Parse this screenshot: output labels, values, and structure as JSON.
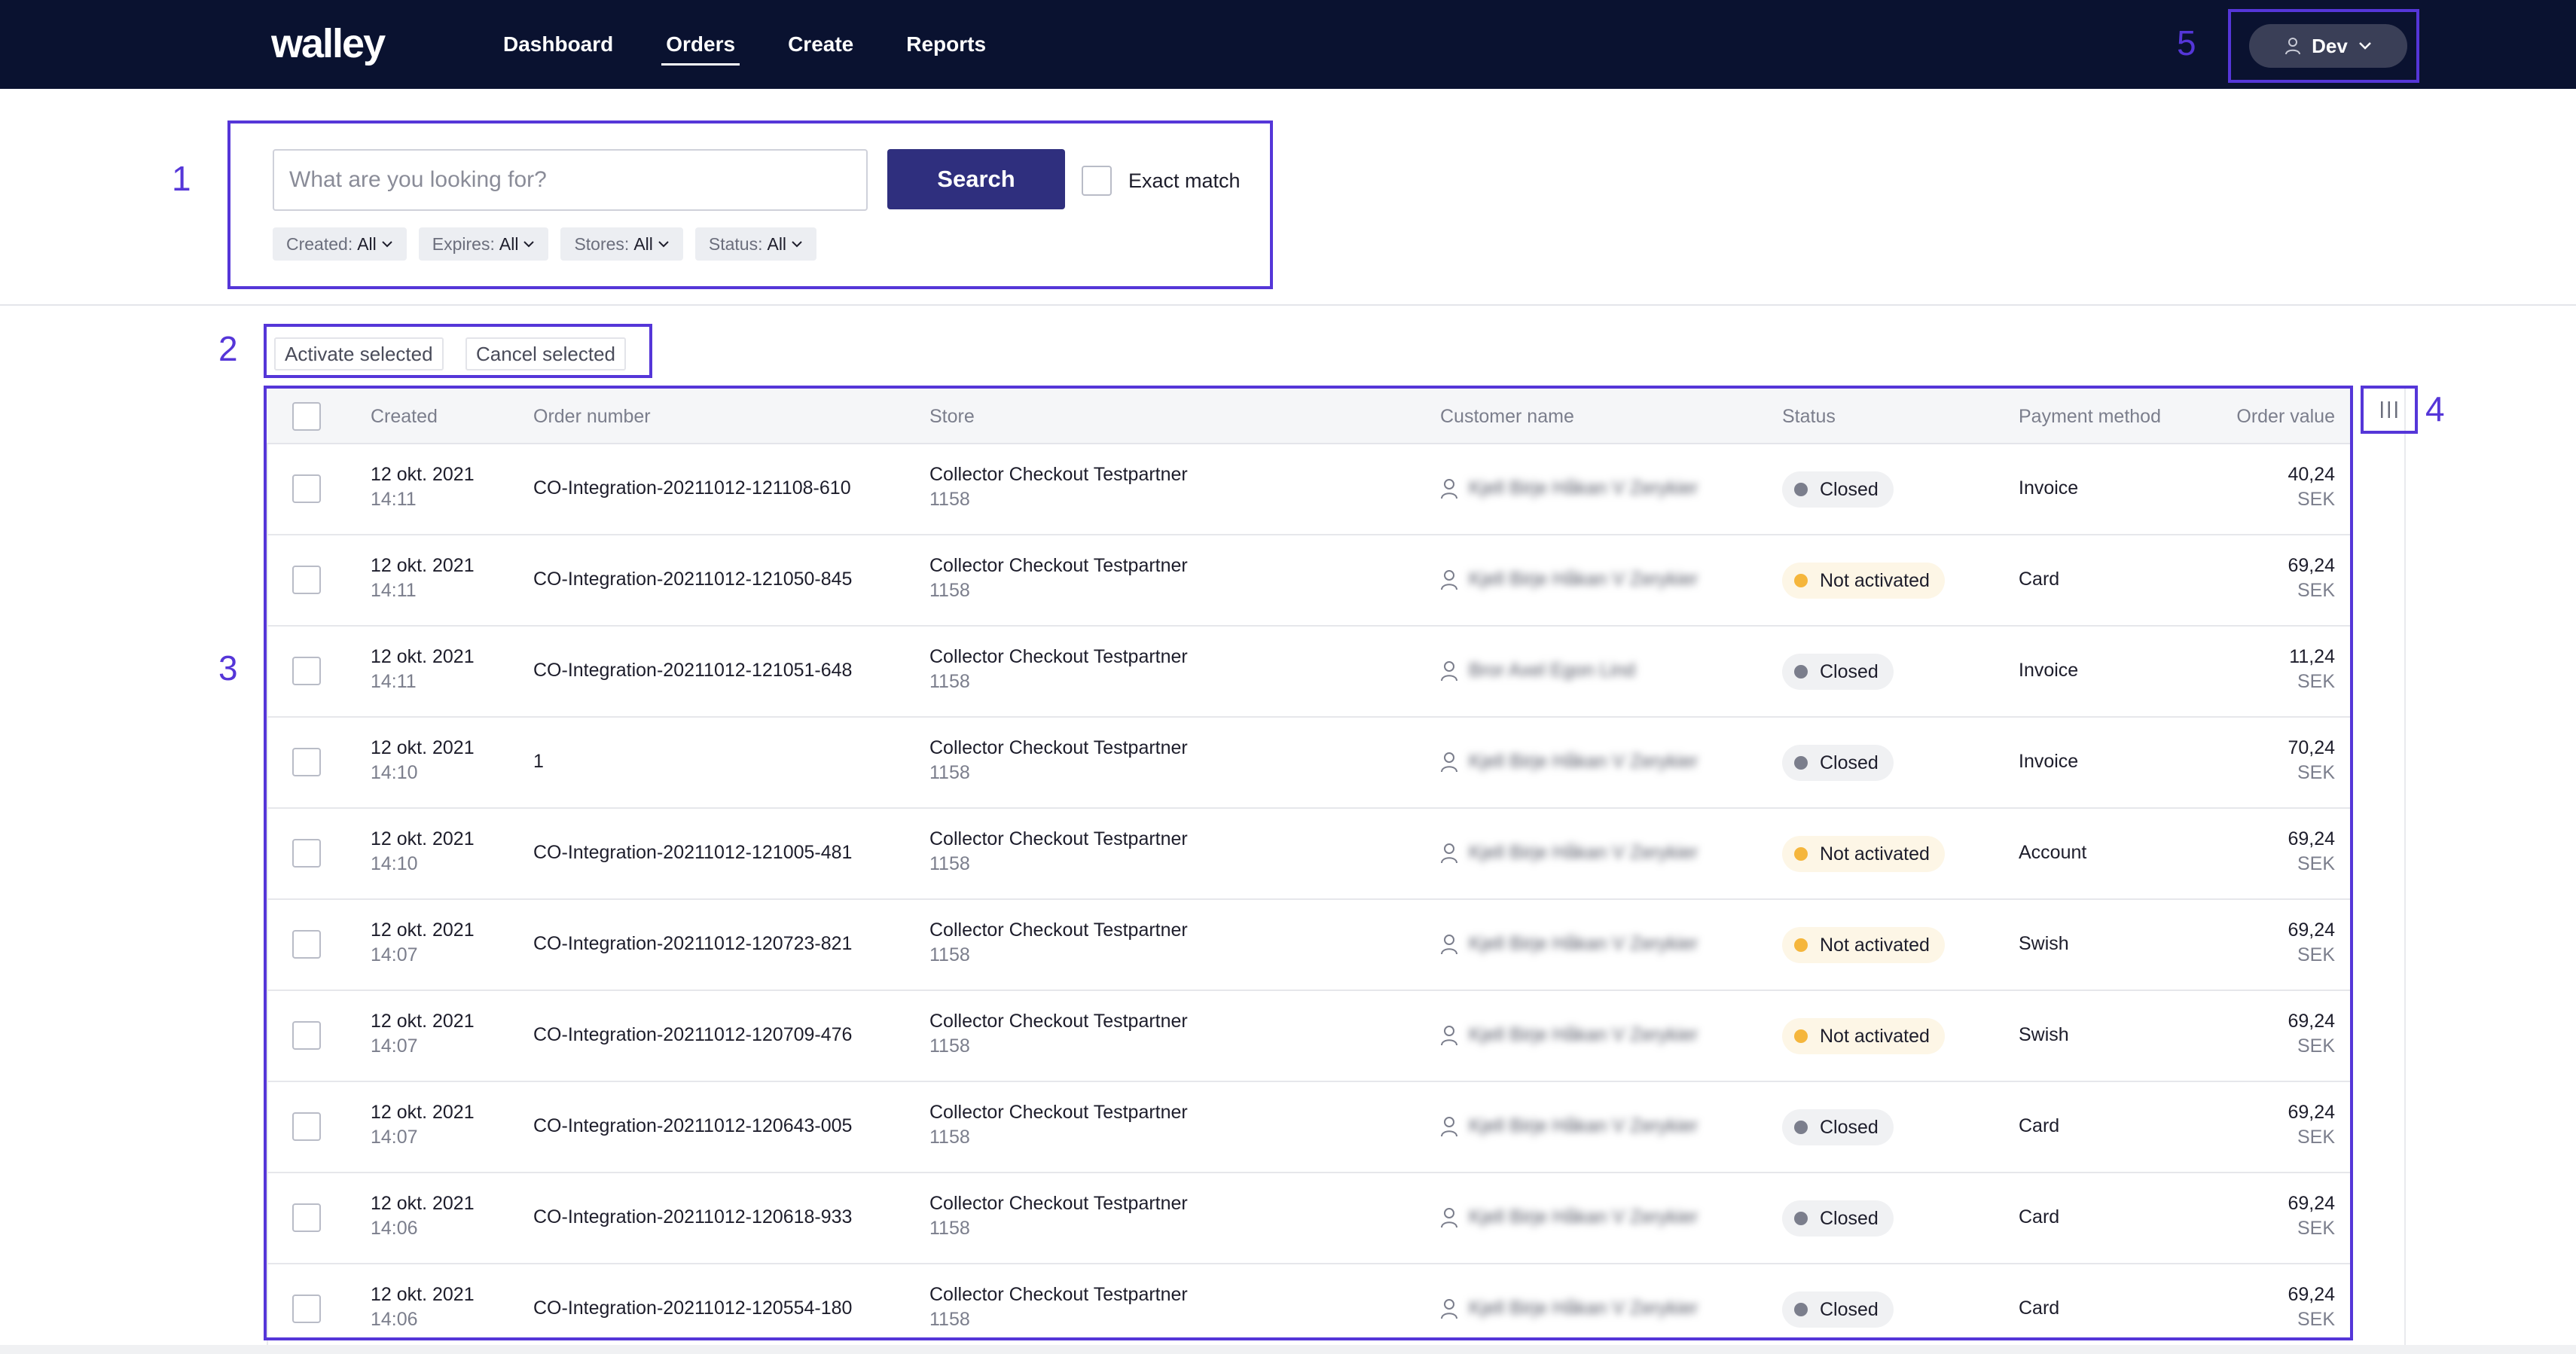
{
  "brand": {
    "logo_text": "walley",
    "nav_bg": "#0a1230",
    "accent": "#2f2f7e",
    "annotation_color": "#5536d8"
  },
  "nav": {
    "items": [
      {
        "label": "Dashboard",
        "active": false
      },
      {
        "label": "Orders",
        "active": true
      },
      {
        "label": "Create",
        "active": false
      },
      {
        "label": "Reports",
        "active": false
      }
    ],
    "user_label": "Dev"
  },
  "annotations": {
    "a1": "1",
    "a2": "2",
    "a3": "3",
    "a4": "4",
    "a5": "5"
  },
  "search": {
    "placeholder": "What are you looking for?",
    "value": "",
    "button_label": "Search",
    "exact_match_label": "Exact match"
  },
  "filters": [
    {
      "key": "Created:",
      "value": "All"
    },
    {
      "key": "Expires:",
      "value": "All"
    },
    {
      "key": "Stores:",
      "value": "All"
    },
    {
      "key": "Status:",
      "value": "All"
    }
  ],
  "actions": {
    "activate": "Activate selected",
    "cancel": "Cancel selected"
  },
  "table": {
    "headers": [
      "Created",
      "Order number",
      "Store",
      "Customer name",
      "Status",
      "Payment method",
      "Order value"
    ],
    "rows": [
      {
        "date": "12 okt. 2021",
        "time": "14:11",
        "order": "CO-Integration-20211012-121108-610",
        "store": "Collector Checkout Testpartner",
        "store_id": "1158",
        "customer": "Kjell Birje Håkan V Zerykier",
        "status": "Closed",
        "status_type": "closed",
        "payment": "Invoice",
        "amount": "40,24",
        "currency": "SEK"
      },
      {
        "date": "12 okt. 2021",
        "time": "14:11",
        "order": "CO-Integration-20211012-121050-845",
        "store": "Collector Checkout Testpartner",
        "store_id": "1158",
        "customer": "Kjell Birje Håkan V Zerykier",
        "status": "Not activated",
        "status_type": "warn",
        "payment": "Card",
        "amount": "69,24",
        "currency": "SEK"
      },
      {
        "date": "12 okt. 2021",
        "time": "14:11",
        "order": "CO-Integration-20211012-121051-648",
        "store": "Collector Checkout Testpartner",
        "store_id": "1158",
        "customer": "Bror Axel Egon Lind",
        "status": "Closed",
        "status_type": "closed",
        "payment": "Invoice",
        "amount": "11,24",
        "currency": "SEK"
      },
      {
        "date": "12 okt. 2021",
        "time": "14:10",
        "order": "1",
        "store": "Collector Checkout Testpartner",
        "store_id": "1158",
        "customer": "Kjell Birje Håkan V Zerykier",
        "status": "Closed",
        "status_type": "closed",
        "payment": "Invoice",
        "amount": "70,24",
        "currency": "SEK"
      },
      {
        "date": "12 okt. 2021",
        "time": "14:10",
        "order": "CO-Integration-20211012-121005-481",
        "store": "Collector Checkout Testpartner",
        "store_id": "1158",
        "customer": "Kjell Birje Håkan V Zerykier",
        "status": "Not activated",
        "status_type": "warn",
        "payment": "Account",
        "amount": "69,24",
        "currency": "SEK"
      },
      {
        "date": "12 okt. 2021",
        "time": "14:07",
        "order": "CO-Integration-20211012-120723-821",
        "store": "Collector Checkout Testpartner",
        "store_id": "1158",
        "customer": "Kjell Birje Håkan V Zerykier",
        "status": "Not activated",
        "status_type": "warn",
        "payment": "Swish",
        "amount": "69,24",
        "currency": "SEK"
      },
      {
        "date": "12 okt. 2021",
        "time": "14:07",
        "order": "CO-Integration-20211012-120709-476",
        "store": "Collector Checkout Testpartner",
        "store_id": "1158",
        "customer": "Kjell Birje Håkan V Zerykier",
        "status": "Not activated",
        "status_type": "warn",
        "payment": "Swish",
        "amount": "69,24",
        "currency": "SEK"
      },
      {
        "date": "12 okt. 2021",
        "time": "14:07",
        "order": "CO-Integration-20211012-120643-005",
        "store": "Collector Checkout Testpartner",
        "store_id": "1158",
        "customer": "Kjell Birje Håkan V Zerykier",
        "status": "Closed",
        "status_type": "closed",
        "payment": "Card",
        "amount": "69,24",
        "currency": "SEK"
      },
      {
        "date": "12 okt. 2021",
        "time": "14:06",
        "order": "CO-Integration-20211012-120618-933",
        "store": "Collector Checkout Testpartner",
        "store_id": "1158",
        "customer": "Kjell Birje Håkan V Zerykier",
        "status": "Closed",
        "status_type": "closed",
        "payment": "Card",
        "amount": "69,24",
        "currency": "SEK"
      },
      {
        "date": "12 okt. 2021",
        "time": "14:06",
        "order": "CO-Integration-20211012-120554-180",
        "store": "Collector Checkout Testpartner",
        "store_id": "1158",
        "customer": "Kjell Birje Håkan V Zerykier",
        "status": "Closed",
        "status_type": "closed",
        "payment": "Card",
        "amount": "69,24",
        "currency": "SEK"
      }
    ]
  },
  "status_colors": {
    "closed": "#7b7e8c",
    "warn": "#f5b63c"
  },
  "icons": {
    "user": "user-icon",
    "chevron": "chevron-down-icon",
    "columns": "columns-icon"
  }
}
